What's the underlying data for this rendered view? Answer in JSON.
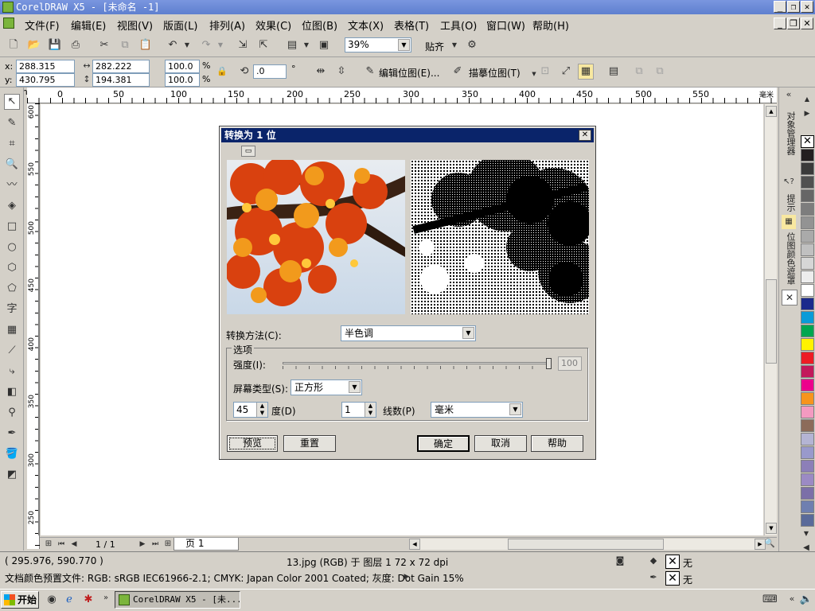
{
  "window": {
    "title": "CorelDRAW X5 - [未命名 -1]",
    "min": "_",
    "restore": "❐",
    "close": "✕"
  },
  "menu": [
    "文件(F)",
    "编辑(E)",
    "视图(V)",
    "版面(L)",
    "排列(A)",
    "效果(C)",
    "位图(B)",
    "文本(X)",
    "表格(T)",
    "工具(O)",
    "窗口(W)",
    "帮助(H)"
  ],
  "toolbar": {
    "zoom": "39%",
    "snap": "贴齐"
  },
  "propbar": {
    "x_label": "x:",
    "x_value": "288.315 mm",
    "y_label": "y:",
    "y_value": "430.795 mm",
    "w_value": "282.222 mm",
    "h_value": "194.381 mm",
    "scale_x": "100.0",
    "scale_y": "100.0",
    "pct": "%",
    "rotate": ".0",
    "deg": "°",
    "edit_bitmap": "编辑位图(E)...",
    "trace_bitmap": "描摹位图(T)"
  },
  "ruler": {
    "h_ticks": [
      "0",
      "50",
      "100",
      "150",
      "200",
      "250",
      "300",
      "350",
      "400",
      "450",
      "500",
      "550"
    ],
    "h_unit": "毫米",
    "v_ticks": [
      "600",
      "550",
      "500",
      "450",
      "400",
      "350",
      "300",
      "250"
    ]
  },
  "dialog": {
    "title": "转换为 1 位",
    "method_label": "转换方法(C):",
    "method_value": "半色调",
    "options_label": "选项",
    "intensity_label": "强度(I):",
    "intensity_value": "100",
    "screen_label": "屏幕类型(S):",
    "screen_value": "正方形",
    "angle_value": "45",
    "angle_label": "度(D)",
    "lines_value": "1",
    "lines_label": "线数(P)",
    "unit_value": "毫米",
    "preview": "预览",
    "reset": "重置",
    "ok": "确定",
    "cancel": "取消",
    "help": "帮助"
  },
  "docker_tabs": [
    "对象管理器",
    "提示",
    "位图颜色遮罩"
  ],
  "palette": [
    "#231f20",
    "#3a3a3a",
    "#505050",
    "#666666",
    "#7d7d7d",
    "#939393",
    "#aaaaaa",
    "#c0c0c0",
    "#d6d6d6",
    "#ededed",
    "#ffffff",
    "#1b2a8c",
    "#0a9bd8",
    "#00a650",
    "#fff200",
    "#ed1c24",
    "#c2185b",
    "#ec008c",
    "#f7941d",
    "#f49ac1",
    "#8c6b5a",
    "#b4b4d4",
    "#9999cc",
    "#8c7fb8",
    "#9b8ac4",
    "#7b6fa8",
    "#6f7fb0",
    "#5a6a9a"
  ],
  "pages": {
    "counter": "1 / 1",
    "tab": "页 1"
  },
  "status": {
    "coords": "( 295.976, 590.770 )",
    "info": "13.jpg (RGB) 于 图层 1 72 x 72 dpi",
    "profile": "文档颜色预置文件: RGB: sRGB IEC61966-2.1; CMYK: Japan Color 2001 Coated; 灰度: Dot Gain 15%",
    "fill_none": "无",
    "outline_none": "无"
  },
  "taskbar": {
    "start": "开始",
    "task": "CorelDRAW X5 - [未..."
  }
}
